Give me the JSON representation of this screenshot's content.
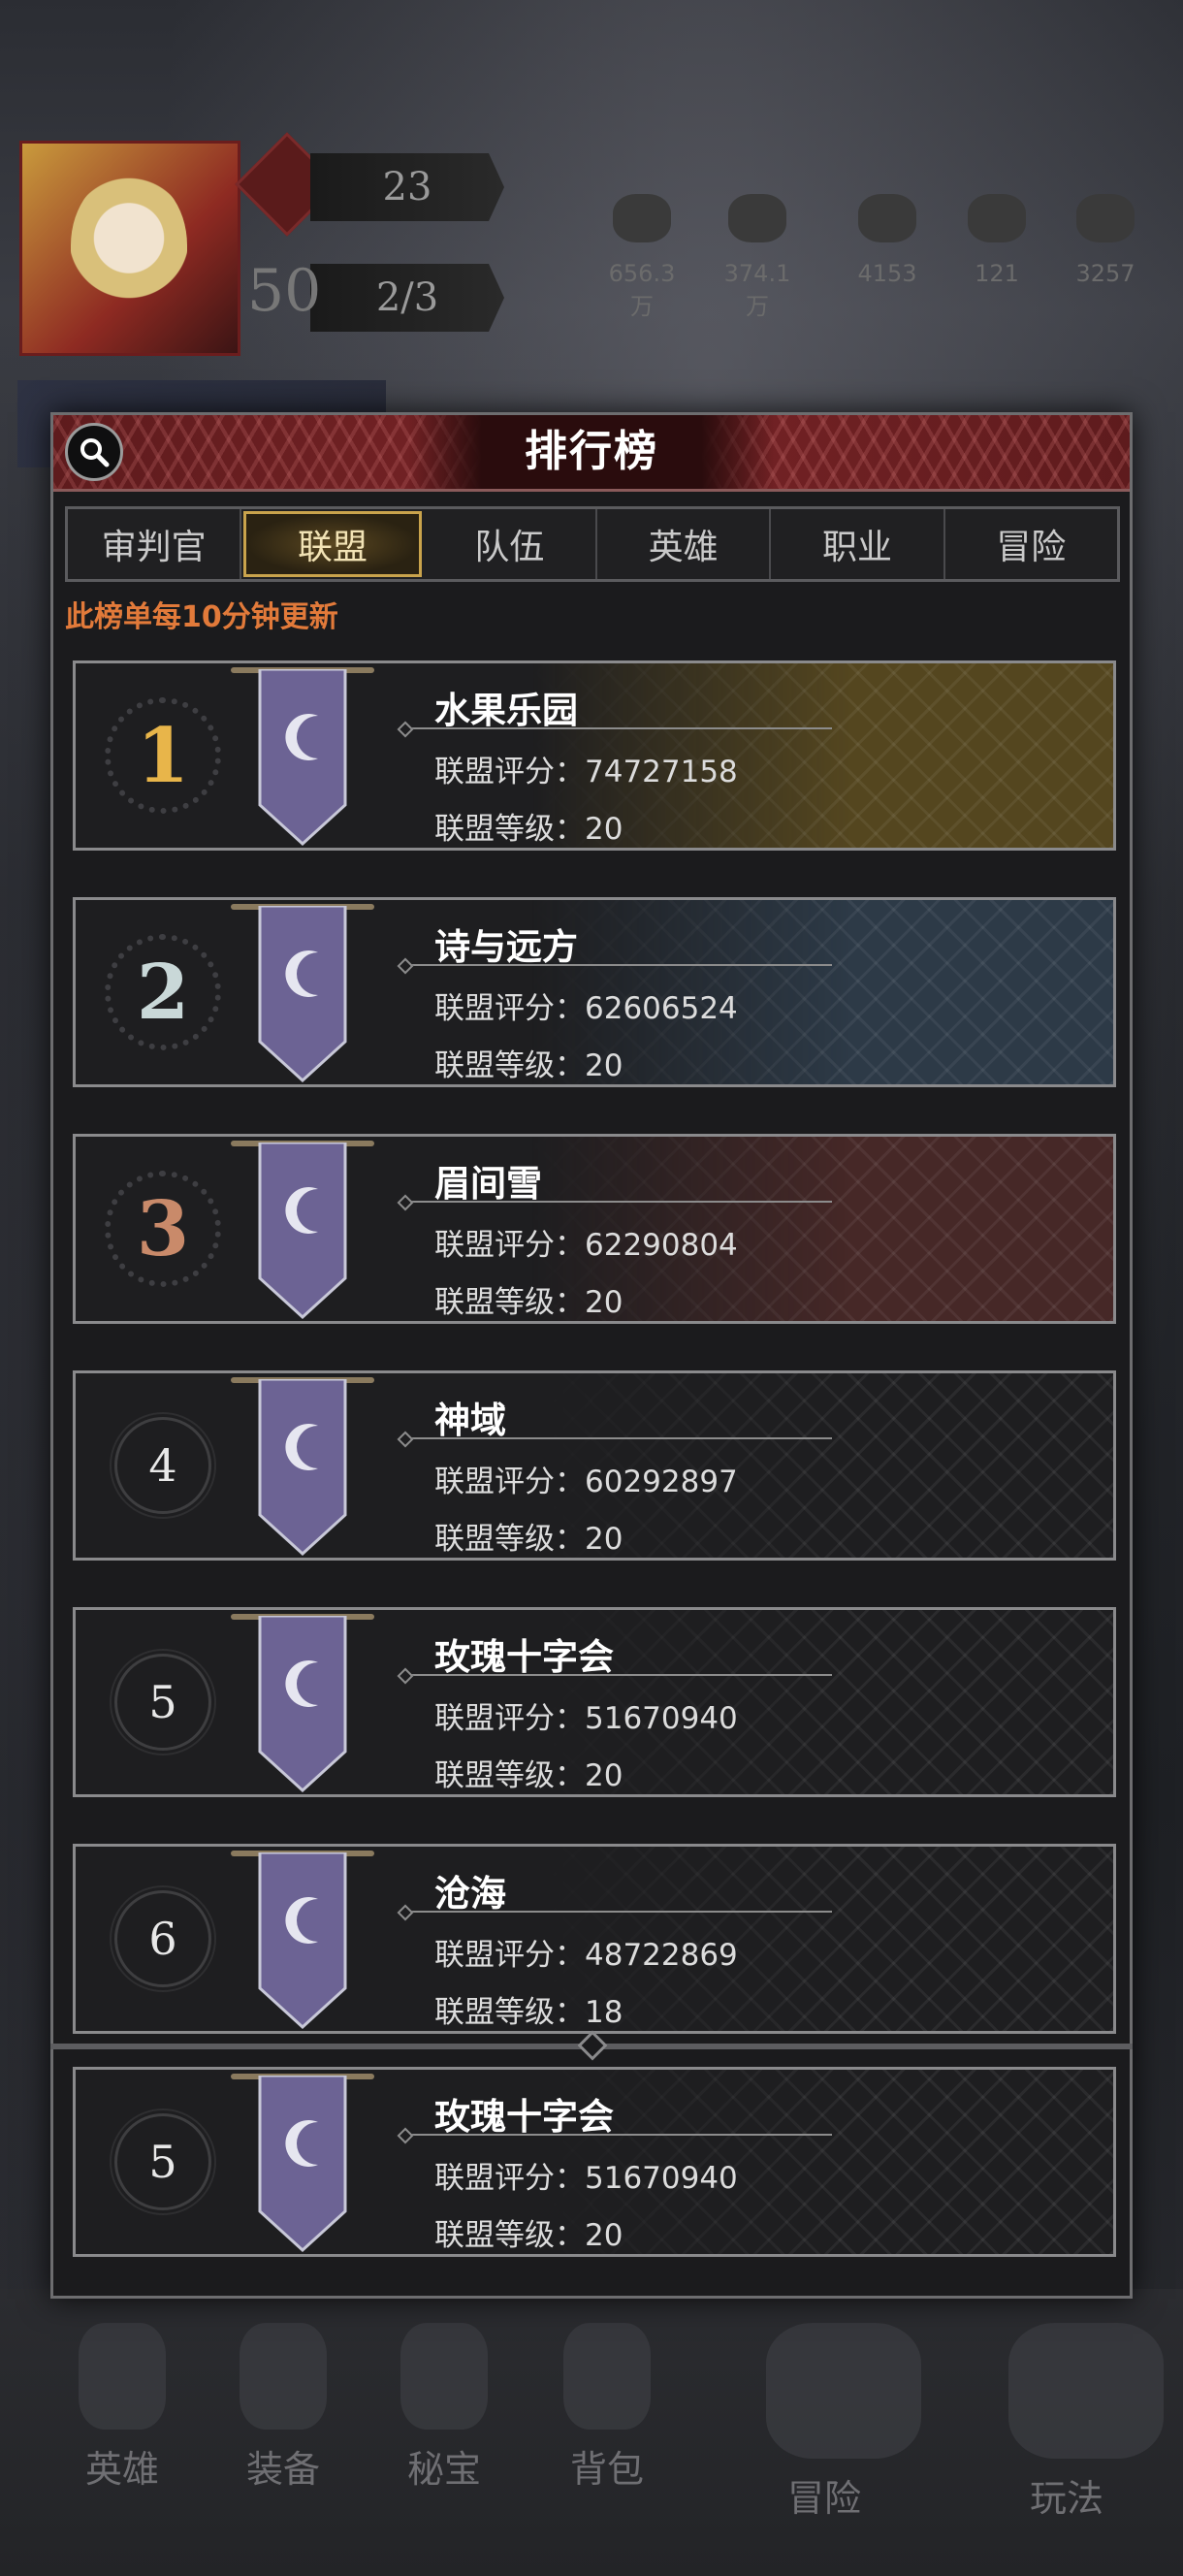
{
  "hud": {
    "level": "50",
    "power": "23",
    "energy": "2/3",
    "resources": [
      "656.3万",
      "374.1万",
      "4153",
      "121",
      "3257"
    ]
  },
  "nav": [
    "英雄",
    "装备",
    "秘宝",
    "背包",
    "冒险",
    "玩法"
  ],
  "panel": {
    "title": "排行榜",
    "notice": "此榜单每10分钟更新",
    "tabs": [
      "审判官",
      "联盟",
      "队伍",
      "英雄",
      "职业",
      "冒险"
    ],
    "active_tab": "联盟"
  },
  "labels": {
    "score": "联盟评分：",
    "level": "联盟等级："
  },
  "rankings": [
    {
      "rank": "1",
      "name": "水果乐园",
      "score": "74727158",
      "level": "20"
    },
    {
      "rank": "2",
      "name": "诗与远方",
      "score": "62606524",
      "level": "20"
    },
    {
      "rank": "3",
      "name": "眉间雪",
      "score": "62290804",
      "level": "20"
    },
    {
      "rank": "4",
      "name": "神域",
      "score": "60292897",
      "level": "20"
    },
    {
      "rank": "5",
      "name": "玫瑰十字会",
      "score": "51670940",
      "level": "20"
    },
    {
      "rank": "6",
      "name": "沧海",
      "score": "48722869",
      "level": "18"
    }
  ],
  "my_ranking": {
    "rank": "5",
    "name": "玫瑰十字会",
    "score": "51670940",
    "level": "20"
  },
  "colors": {
    "header": "#6e2023",
    "notice": "#e27a3a",
    "gold": "#e8b54a",
    "silver": "#c9d8d8",
    "bronze": "#c98a6a",
    "banner": "#6c6394"
  }
}
